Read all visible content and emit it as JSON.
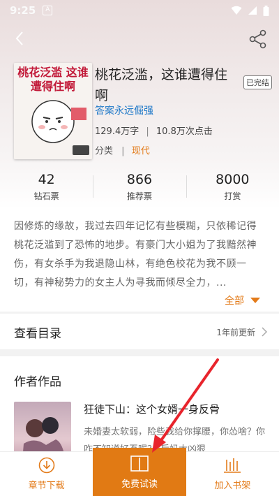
{
  "status_bar": {
    "time": "9:25",
    "notification_glyph": "A"
  },
  "book": {
    "title": "桃花泛滥，这谁遭得住啊",
    "status_badge": "已完结",
    "author": "答案永远倔强",
    "word_count": "129.4万字",
    "separator": "|",
    "clicks": "10.8万次点击",
    "category_label": "分类",
    "category_value": "现代",
    "cover_title": "桃花泛滥 这谁遭得住啊"
  },
  "counters": [
    {
      "value": "42",
      "label": "钻石票"
    },
    {
      "value": "866",
      "label": "推荐票"
    },
    {
      "value": "8000",
      "label": "打赏"
    }
  ],
  "synopsis": "因修炼的缘故，我过去四年记忆有些模糊，只依稀记得桃花泛滥到了恐怖的地步。有豪门大小姐为了我黯然神伤，有女杀手为我退隐山林，有绝色校花为我不顾一切，有神秘势力的女主人为寻我而倾尽全力，...",
  "expand_label": "全部",
  "toc": {
    "label": "查看目录",
    "update": "1年前更新"
  },
  "author_works": {
    "section_title": "作者作品",
    "items": [
      {
        "title": "狂徒下山：这个女婿一身反骨",
        "desc": "未婚妻太软弱，险些我给你撑腰，你怂啥？你咋不知道好歹呢？\"后妈太凶狠"
      }
    ]
  },
  "bottom_bar": {
    "download": "章节下载",
    "read_free": "免费试读",
    "add_shelf": "加入书架"
  },
  "colors": {
    "accent": "#e17a14",
    "author_link": "#1e78c8",
    "annotation_arrow": "#e8242c"
  }
}
